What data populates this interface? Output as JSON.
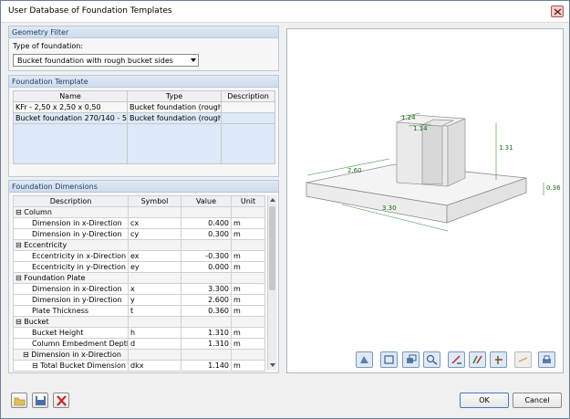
{
  "window": {
    "title": "User Database of Foundation Templates"
  },
  "geometry_filter": {
    "header": "Geometry Filter",
    "type_label": "Type of foundation:",
    "type_value": "Bucket foundation with rough bucket sides"
  },
  "template": {
    "header": "Foundation Template",
    "columns": [
      "Name",
      "Type",
      "Description"
    ],
    "rows": [
      {
        "name": "KFr - 2,50 x 2,50 x 0,50",
        "type": "Bucket foundation (rough)",
        "description": ""
      },
      {
        "name": "Bucket foundation 270/140 - 50",
        "type": "Bucket foundation (rough)",
        "description": ""
      }
    ]
  },
  "dimensions": {
    "header": "Foundation Dimensions",
    "columns": [
      "Description",
      "Symbol",
      "Value",
      "Unit"
    ],
    "rows": [
      {
        "kind": "group",
        "label": "⊟ Column",
        "symbol": "",
        "value": "",
        "unit": ""
      },
      {
        "kind": "row",
        "label": "Dimension in x-Direction",
        "symbol": "cx",
        "value": "0.400",
        "unit": "m"
      },
      {
        "kind": "row",
        "label": "Dimension in y-Direction",
        "symbol": "cy",
        "value": "0.300",
        "unit": "m"
      },
      {
        "kind": "group",
        "label": "⊟ Eccentricity",
        "symbol": "",
        "value": "",
        "unit": ""
      },
      {
        "kind": "row",
        "label": "Eccentricity in x-Direction",
        "symbol": "ex",
        "value": "-0.300",
        "unit": "m"
      },
      {
        "kind": "row",
        "label": "Eccentricity in y-Direction",
        "symbol": "ey",
        "value": "0.000",
        "unit": "m"
      },
      {
        "kind": "group",
        "label": "⊟ Foundation Plate",
        "symbol": "",
        "value": "",
        "unit": ""
      },
      {
        "kind": "row",
        "label": "Dimension in x-Direction",
        "symbol": "x",
        "value": "3.300",
        "unit": "m"
      },
      {
        "kind": "row",
        "label": "Dimension in y-Direction",
        "symbol": "y",
        "value": "2.600",
        "unit": "m"
      },
      {
        "kind": "row",
        "label": "Plate Thickness",
        "symbol": "t",
        "value": "0.360",
        "unit": "m"
      },
      {
        "kind": "group",
        "label": "⊟ Bucket",
        "symbol": "",
        "value": "",
        "unit": ""
      },
      {
        "kind": "row",
        "label": "Bucket Height",
        "symbol": "h",
        "value": "1.310",
        "unit": "m"
      },
      {
        "kind": "row",
        "label": "Column Embedment Depth",
        "symbol": "d",
        "value": "1.310",
        "unit": "m"
      },
      {
        "kind": "subgroup",
        "label": "⊟ Dimension in x-Direction",
        "symbol": "",
        "value": "",
        "unit": ""
      },
      {
        "kind": "subrow",
        "label": "⊟ Total Bucket Dimension",
        "symbol": "dkx",
        "value": "1.140",
        "unit": "m"
      }
    ]
  },
  "preview": {
    "dims": {
      "top_a": "1.24",
      "top_b": "1.14",
      "height": "1.31",
      "plate_y": "2.60",
      "plate_x": "3.30",
      "thickness": "0.36"
    }
  },
  "toolbar_icons": [
    "render-mode-icon",
    "view-3d-icon",
    "view-iso-icon",
    "zoom-icon",
    "view-x-icon",
    "view-y-icon",
    "view-z-icon",
    "dimensions-icon",
    "print-icon"
  ],
  "buttons": {
    "ok": "OK",
    "cancel": "Cancel"
  }
}
